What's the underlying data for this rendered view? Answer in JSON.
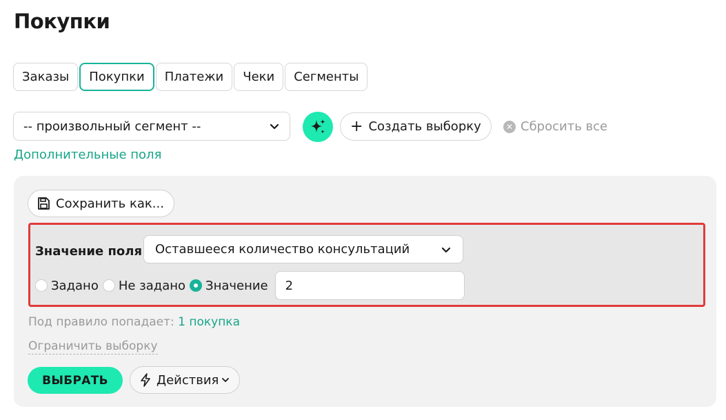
{
  "page": {
    "title": "Покупки"
  },
  "tabs": [
    {
      "label": "Заказы",
      "active": false
    },
    {
      "label": "Покупки",
      "active": true
    },
    {
      "label": "Платежи",
      "active": false
    },
    {
      "label": "Чеки",
      "active": false
    },
    {
      "label": "Сегменты",
      "active": false
    }
  ],
  "toolbar": {
    "segment_value": "-- произвольный сегмент --",
    "create_label": "Создать выборку",
    "reset_label": "Сбросить все"
  },
  "extra_fields_link": "Дополнительные поля",
  "panel": {
    "save_label": "Сохранить как...",
    "rule": {
      "field_label": "Значение поля",
      "field_value": "Оставшееся количество консультаций",
      "options": [
        {
          "label": "Задано",
          "checked": false
        },
        {
          "label": "Не задано",
          "checked": false
        },
        {
          "label": "Значение",
          "checked": true
        }
      ],
      "value": "2"
    },
    "hint_prefix": "Под правило попадает:",
    "hint_count": "1 покупка",
    "limit_label": "Ограничить выборку",
    "choose_label": "ВЫБРАТЬ",
    "actions_label": "Действия"
  },
  "colors": {
    "accent": "#1ee9b0",
    "accent_dark": "#17b39a",
    "link": "#17a589",
    "highlight_border": "#e03a3a"
  },
  "icons": [
    "chevron-down-icon",
    "sparkles-icon",
    "plus-icon",
    "close-circle-icon",
    "save-icon",
    "radio-icon",
    "lightning-icon"
  ]
}
